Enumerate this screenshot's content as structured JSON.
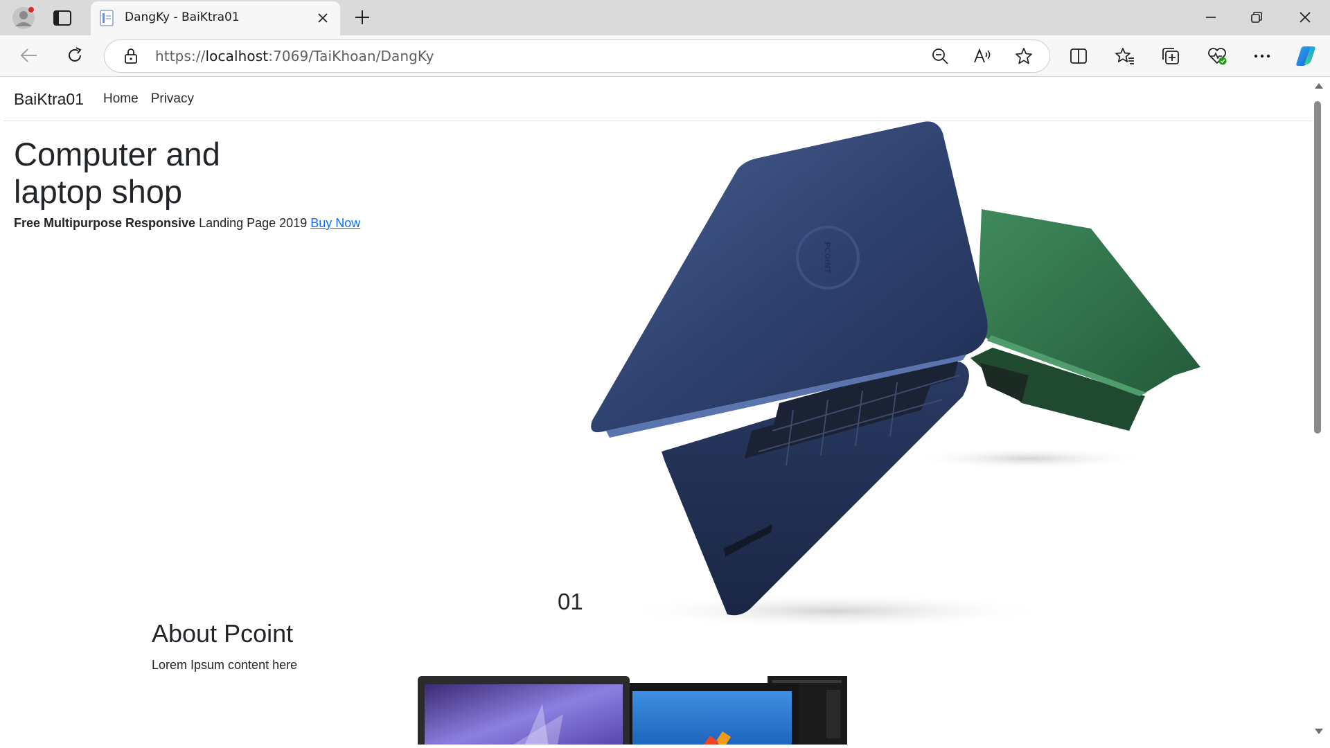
{
  "browser": {
    "tab": {
      "title": "DangKy - BaiKtra01"
    },
    "address_bar": {
      "protocol": "https://",
      "host": "localhost",
      "path": ":7069/TaiKhoan/DangKy"
    }
  },
  "site": {
    "nav": {
      "brand": "BaiKtra01",
      "links": [
        "Home",
        "Privacy"
      ]
    },
    "hero": {
      "title": "Computer and laptop shop",
      "subtitle_bold": "Free Multipurpose Responsive",
      "subtitle_text": " Landing Page 2019 ",
      "cta_label": "Buy Now"
    },
    "counter": "01",
    "about": {
      "title": "About Pcoint",
      "text": "Lorem Ipsum content here"
    },
    "laptop_logo": "PCOINT"
  },
  "colors": {
    "link": "#0d6efd",
    "text": "#212529",
    "laptop_blue": "#2c3f66",
    "laptop_green": "#2e7048"
  },
  "icons": [
    "profile-icon",
    "tab-actions-icon",
    "page-favicon-icon",
    "close-icon",
    "plus-icon",
    "minimize-icon",
    "restore-icon",
    "window-close-icon",
    "back-arrow-icon",
    "refresh-icon",
    "lock-icon",
    "zoom-out-icon",
    "read-aloud-icon",
    "favorite-star-icon",
    "split-screen-icon",
    "favorites-icon",
    "collections-icon",
    "performance-icon",
    "more-icon",
    "copilot-icon"
  ]
}
